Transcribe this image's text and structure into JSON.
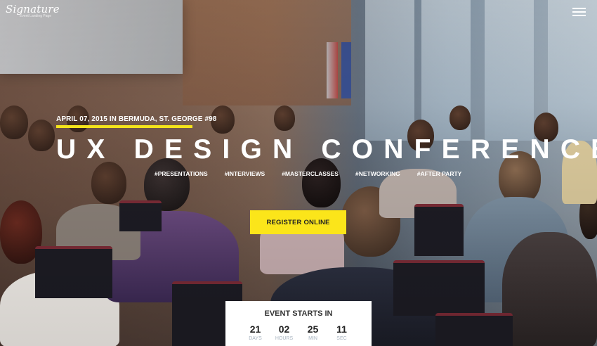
{
  "header": {
    "logo_name": "Signature",
    "logo_tagline": "Event Landing Page",
    "menu_icon": "hamburger-menu-icon"
  },
  "hero": {
    "date_location": "APRIL 07, 2015 IN BERMUDA, ST. GEORGE #98",
    "title": "UX DESIGN CONFERENCE",
    "tags": [
      "#PRESENTATIONS",
      "#INTERVIEWS",
      "#MASTERCLASSES",
      "#NETWORKING",
      "#AFTER PARTY"
    ],
    "register_label": "REGISTER ONLINE",
    "accent_color": "#f4e31b"
  },
  "countdown": {
    "heading": "EVENT STARTS IN",
    "items": [
      {
        "value": "21",
        "label": "DAYS"
      },
      {
        "value": "02",
        "label": "HOURS"
      },
      {
        "value": "25",
        "label": "MIN"
      },
      {
        "value": "11",
        "label": "SEC"
      }
    ]
  }
}
